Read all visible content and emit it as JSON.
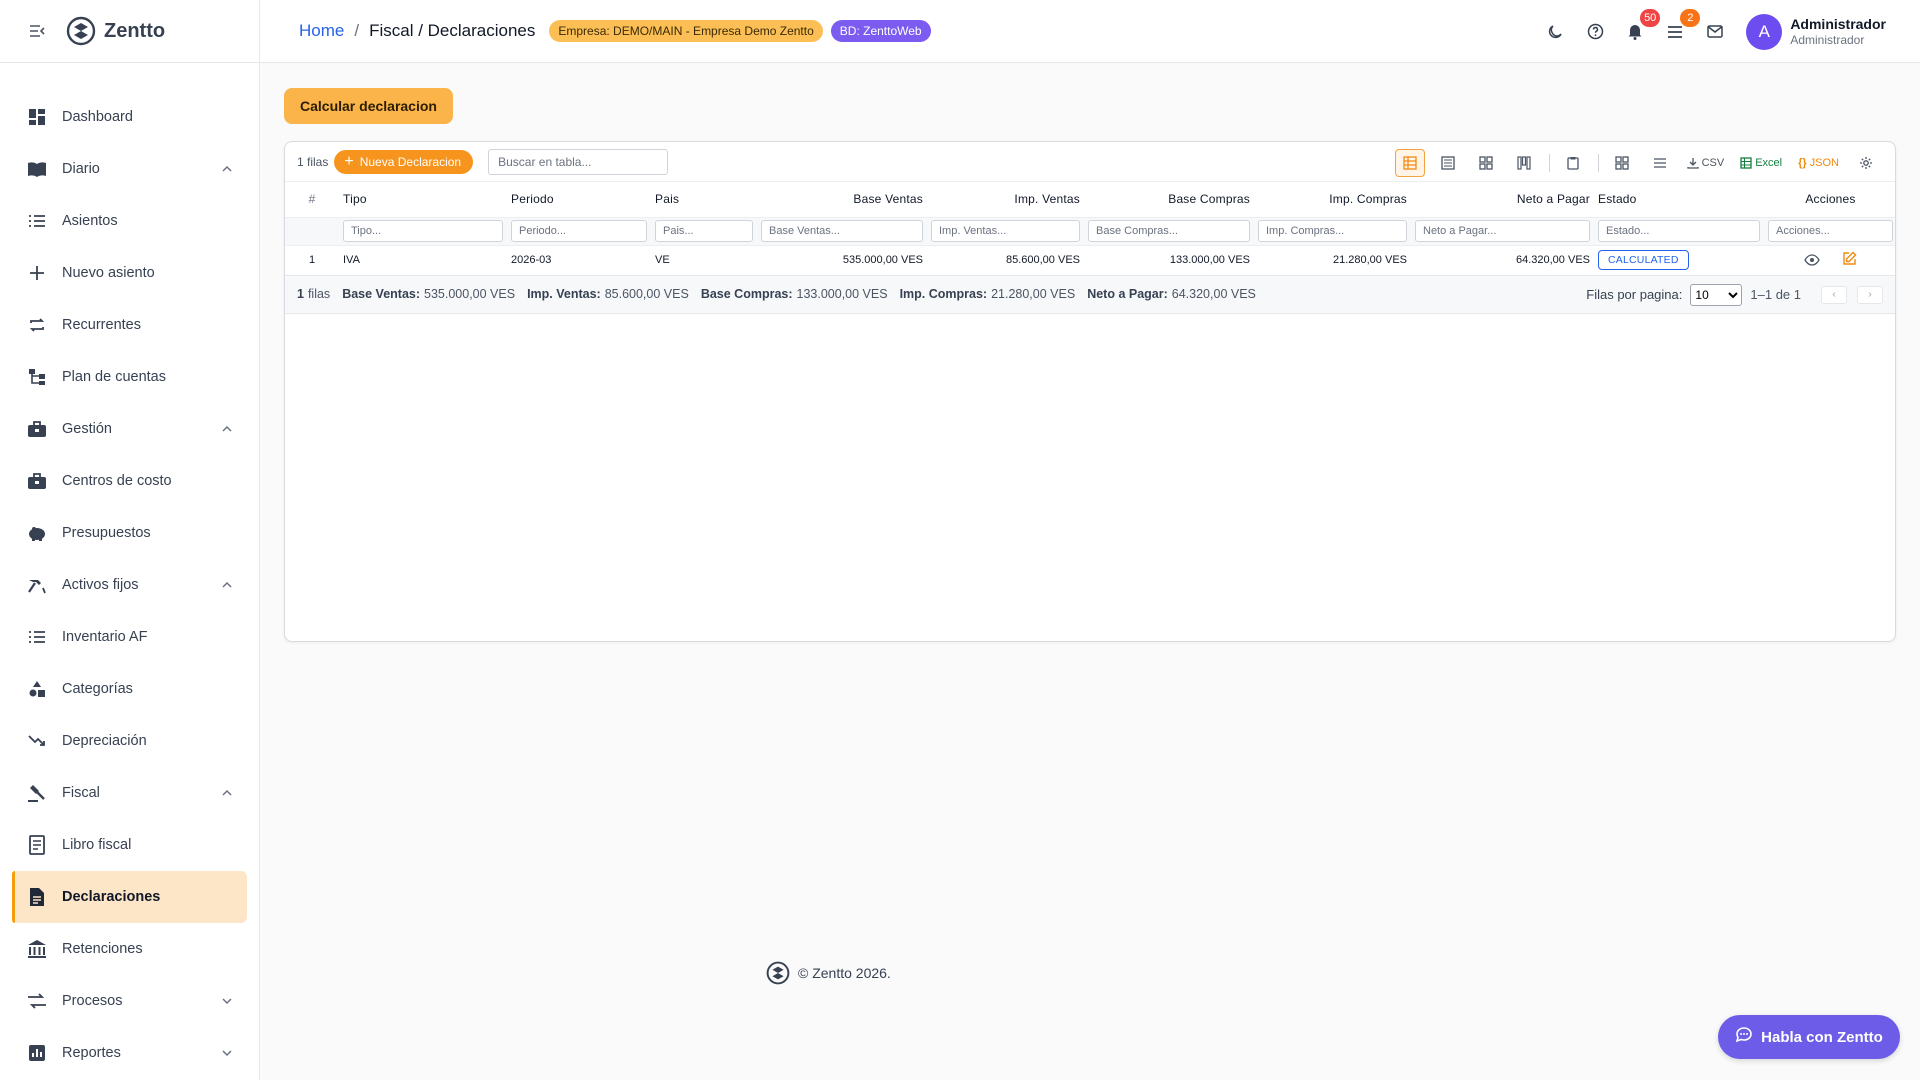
{
  "brand": {
    "name": "Zentto"
  },
  "sidebar": {
    "items": [
      {
        "label": "Dashboard",
        "icon": "dashboard-icon"
      },
      {
        "label": "Diario",
        "icon": "book-icon",
        "expandable": true,
        "expanded": true
      },
      {
        "label": "Asientos",
        "icon": "list-icon"
      },
      {
        "label": "Nuevo asiento",
        "icon": "plus-icon"
      },
      {
        "label": "Recurrentes",
        "icon": "repeat-icon"
      },
      {
        "label": "Plan de cuentas",
        "icon": "tree-icon"
      },
      {
        "label": "Gestión",
        "icon": "briefcase-icon",
        "expandable": true,
        "expanded": true
      },
      {
        "label": "Centros de costo",
        "icon": "briefcase-icon"
      },
      {
        "label": "Presupuestos",
        "icon": "piggy-bank-icon"
      },
      {
        "label": "Activos fijos",
        "icon": "hammer-icon",
        "expandable": true,
        "expanded": true
      },
      {
        "label": "Inventario AF",
        "icon": "list-icon"
      },
      {
        "label": "Categorías",
        "icon": "category-icon"
      },
      {
        "label": "Depreciación",
        "icon": "trending-down-icon"
      },
      {
        "label": "Fiscal",
        "icon": "gavel-icon",
        "expandable": true,
        "expanded": true
      },
      {
        "label": "Libro fiscal",
        "icon": "ledger-icon"
      },
      {
        "label": "Declaraciones",
        "icon": "document-icon",
        "active": true
      },
      {
        "label": "Retenciones",
        "icon": "bank-icon"
      },
      {
        "label": "Procesos",
        "icon": "swap-icon",
        "expandable": true,
        "expanded": false
      },
      {
        "label": "Reportes",
        "icon": "report-icon",
        "expandable": true,
        "expanded": false
      }
    ]
  },
  "header": {
    "breadcrumb_home": "Home",
    "breadcrumb_sep": "/",
    "breadcrumb_current": "Fiscal / Declaraciones",
    "company_pill": "Empresa: DEMO/MAIN - Empresa Demo Zentto",
    "db_pill": "BD: ZenttoWeb",
    "notifications_count": "50",
    "tasks_count": "2",
    "avatar_letter": "A",
    "user_name": "Administrador",
    "user_role": "Administrador"
  },
  "main": {
    "calc_button": "Calcular declaracion",
    "rows_label": "1 filas",
    "new_button": "Nueva Declaracion",
    "search_placeholder": "Buscar en tabla...",
    "tools": {
      "csv": "CSV",
      "excel": "Excel",
      "json": "JSON"
    },
    "columns": {
      "idx": "#",
      "tipo": "Tipo",
      "periodo": "Periodo",
      "pais": "Pais",
      "base_ventas": "Base Ventas",
      "imp_ventas": "Imp. Ventas",
      "base_compras": "Base Compras",
      "imp_compras": "Imp. Compras",
      "neto": "Neto a Pagar",
      "estado": "Estado",
      "acciones": "Acciones"
    },
    "filters": {
      "tipo": "Tipo...",
      "periodo": "Periodo...",
      "pais": "Pais...",
      "base_ventas": "Base Ventas...",
      "imp_ventas": "Imp. Ventas...",
      "base_compras": "Base Compras...",
      "imp_compras": "Imp. Compras...",
      "neto": "Neto a Pagar...",
      "estado": "Estado...",
      "acciones": "Acciones..."
    },
    "rows": [
      {
        "idx": "1",
        "tipo": "IVA",
        "periodo": "2026-03",
        "pais": "VE",
        "base_ventas": "535.000,00 VES",
        "imp_ventas": "85.600,00 VES",
        "base_compras": "133.000,00 VES",
        "imp_compras": "21.280,00 VES",
        "neto": "64.320,00 VES",
        "estado": "CALCULATED"
      }
    ],
    "summary": {
      "rows_num": "1",
      "rows_word": "filas",
      "base_ventas_label": "Base Ventas:",
      "base_ventas_value": "535.000,00 VES",
      "imp_ventas_label": "Imp. Ventas:",
      "imp_ventas_value": "85.600,00 VES",
      "base_compras_label": "Base Compras:",
      "base_compras_value": "133.000,00 VES",
      "imp_compras_label": "Imp. Compras:",
      "imp_compras_value": "21.280,00 VES",
      "neto_label": "Neto a Pagar:",
      "neto_value": "64.320,00 VES"
    },
    "pager": {
      "label": "Filas por pagina:",
      "page_size": "10",
      "range": "1–1 de 1",
      "prev": "‹",
      "next": "›"
    }
  },
  "footer": {
    "text": "© Zentto 2026."
  },
  "chat": {
    "label": "Habla con Zentto"
  },
  "colors": {
    "accent": "#f7941d",
    "calc_button": "#fbb44a",
    "active_nav": "#fde6c8",
    "db_pill": "#7c5cf0",
    "chat": "#6c5ce7",
    "status": "#2563eb"
  }
}
